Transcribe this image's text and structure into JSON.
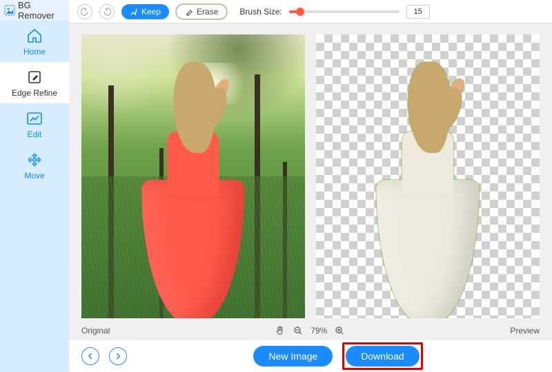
{
  "brand": {
    "name": "BG Remover"
  },
  "sidebar": {
    "items": [
      {
        "label": "Home",
        "icon": "home-icon"
      },
      {
        "label": "Edge Refine",
        "icon": "edge-refine-icon"
      },
      {
        "label": "Edit",
        "icon": "edit-icon"
      },
      {
        "label": "Move",
        "icon": "move-icon"
      }
    ]
  },
  "toolbar": {
    "keep_label": "Keep",
    "erase_label": "Erase",
    "brush_label": "Brush Size:",
    "brush_value": "15"
  },
  "status": {
    "original_label": "Original",
    "preview_label": "Preview",
    "zoom": "79%"
  },
  "bottom": {
    "new_image_label": "New Image",
    "download_label": "Download"
  },
  "colors": {
    "accent": "#1a8cff",
    "mask": "#ff5a4a",
    "highlight": "#e00000"
  }
}
